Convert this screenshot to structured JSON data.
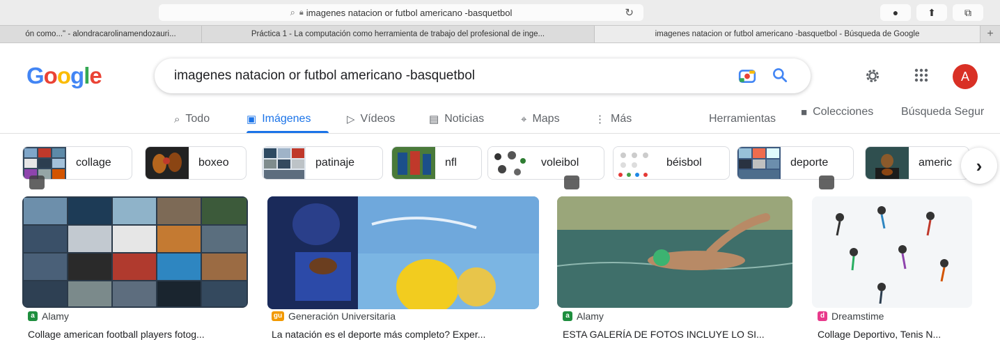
{
  "browser": {
    "address_text": "imagenes natacion or futbol americano -basquetbol",
    "tabs": [
      "ón como...\" - alondracarolinamendozauri...",
      "Práctica 1 - La computación como herramienta de trabajo del profesional de inge...",
      "imagenes natacion or futbol americano -basquetbol - Búsqueda de Google"
    ],
    "new_tab_label": "+"
  },
  "google": {
    "logo_letters": [
      "G",
      "o",
      "o",
      "g",
      "l",
      "e"
    ],
    "logo_colors": [
      "#4285F4",
      "#EA4335",
      "#FBBC05",
      "#4285F4",
      "#34A853",
      "#EA4335"
    ],
    "query": "imagenes natacion or futbol americano -basquetbol",
    "avatar_letter": "A"
  },
  "nav": {
    "tabs": [
      "Todo",
      "Imágenes",
      "Vídeos",
      "Noticias",
      "Maps",
      "Más"
    ],
    "tools": "Herramientas",
    "collections": "Colecciones",
    "safesearch": "Búsqueda Segur"
  },
  "chips": [
    "collage",
    "boxeo",
    "patinaje",
    "nfl",
    "voleibol",
    "béisbol",
    "deporte",
    "americ"
  ],
  "results": [
    {
      "source": "Alamy",
      "title": "Collage american football players fotog...",
      "fav_color": "#1e8e3e",
      "fav_letter": "a"
    },
    {
      "source": "Generación Universitaria",
      "title": "La natación es el deporte más completo? Exper...",
      "fav_color": "#f29900",
      "fav_letter": "gu"
    },
    {
      "source": "Alamy",
      "title": "ESTA GALERÍA DE FOTOS INCLUYE LO SI...",
      "fav_color": "#1e8e3e",
      "fav_letter": "a"
    },
    {
      "source": "Dreamstime",
      "title": "Collage Deportivo, Tenis N...",
      "fav_color": "#e8398b",
      "fav_letter": "d"
    }
  ],
  "colors": {
    "accent": "#1a73e8",
    "avatar": "#d93025"
  }
}
